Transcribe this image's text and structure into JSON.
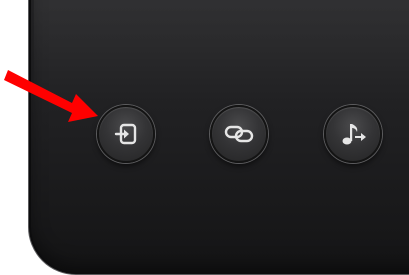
{
  "panel": {
    "background": "#1f1f21",
    "border_color": "#5a5a5c"
  },
  "buttons": [
    {
      "icon": "enter-icon",
      "icon_color": "#e6e6e6"
    },
    {
      "icon": "link-icon",
      "icon_color": "#e6e6e6"
    },
    {
      "icon": "music-forward-icon",
      "icon_color": "#e6e6e6"
    }
  ],
  "annotation": {
    "arrow_color": "#ff0000",
    "points_to": "enter-icon"
  }
}
